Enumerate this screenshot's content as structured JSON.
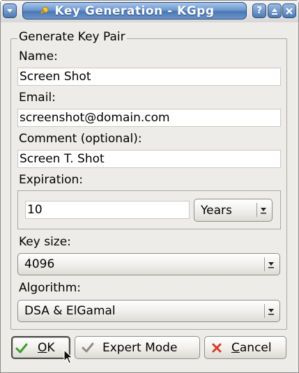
{
  "window": {
    "title": "Key Generation - KGpg"
  },
  "group": {
    "title": "Generate Key Pair"
  },
  "form": {
    "name_label": "Name:",
    "name_value": "Screen Shot",
    "email_label": "Email:",
    "email_value": "screenshot@domain.com",
    "comment_label": "Comment (optional):",
    "comment_value": "Screen T. Shot",
    "expiration_label": "Expiration:",
    "expiration_value": "10",
    "expiration_unit": "Years",
    "keysize_label": "Key size:",
    "keysize_value": "4096",
    "algorithm_label": "Algorithm:",
    "algorithm_value": "DSA & ElGamal"
  },
  "buttons": {
    "ok_mnemonic": "O",
    "ok_rest": "K",
    "expert_label": "Expert Mode",
    "cancel_mnemonic": "C",
    "cancel_rest": "ancel"
  },
  "icons": {
    "menu": "window-menu-icon",
    "app": "kgpg-key-icon",
    "help": "help-icon",
    "shade": "shade-icon",
    "close": "close-icon",
    "ok": "checkmark-icon",
    "expert": "gray-checkmark-icon",
    "cancel": "red-x-icon",
    "dropdown": "dropdown-arrow-icon"
  },
  "colors": {
    "titlebar_accent": "#4a78b4",
    "dialog_bg": "#edece9",
    "ok_check": "#3c9d2a",
    "cancel_x": "#d83a2a"
  }
}
